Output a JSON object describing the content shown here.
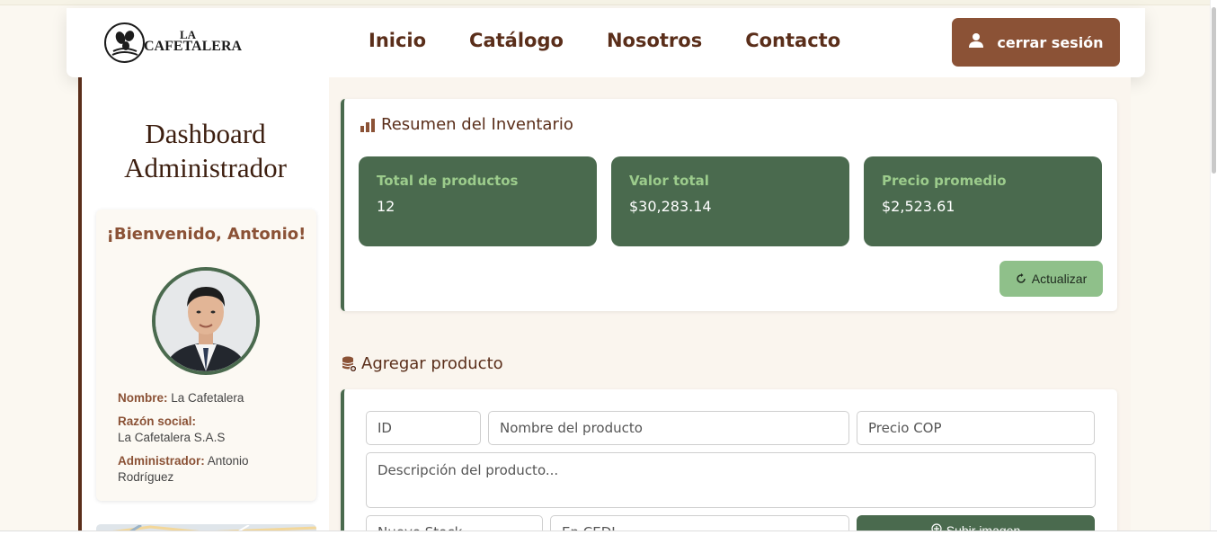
{
  "brand": {
    "logo_small": "LA",
    "logo_name": "CAFETALERA"
  },
  "nav": {
    "links": [
      "Inicio",
      "Catálogo",
      "Nosotros",
      "Contacto"
    ],
    "logout_label": "cerrar sesión",
    "logout_icon": "user-icon"
  },
  "sidebar": {
    "title_line1": "Dashboard",
    "title_line2": "Administrador",
    "welcome": "¡Bienvenido, Antonio!",
    "fields": {
      "nombre_label": "Nombre:",
      "nombre_value": "La Cafetalera",
      "razon_label": "Razón social:",
      "razon_value": "La Cafetalera S.A.S",
      "admin_label": "Administrador:",
      "admin_value": "Antonio Rodríguez"
    }
  },
  "inventory": {
    "title": "Resumen del Inventario",
    "title_icon": "bar-chart-icon",
    "stats": [
      {
        "label": "Total de productos",
        "value": "12"
      },
      {
        "label": "Valor total",
        "value": "$30,283.14"
      },
      {
        "label": "Precio promedio",
        "value": "$2,523.61"
      }
    ],
    "refresh_label": "Actualizar",
    "refresh_icon": "refresh-icon"
  },
  "add_product": {
    "title": "Agregar producto",
    "title_icon": "database-add-icon",
    "placeholders": {
      "id": "ID",
      "name": "Nombre del producto",
      "price": "Precio COP",
      "description": "Descripción del producto...",
      "stock": "Nuevo Stock",
      "select": "En CEDI"
    },
    "upload_label": "Subir imagen",
    "upload_icon": "upload-icon"
  },
  "colors": {
    "brown": "#5a2e1a",
    "accent_brown": "#8b5236",
    "green": "#4a6a4e",
    "light_green": "#8fc08a",
    "stat_label": "#9ccc8c",
    "background": "#faf5ee"
  }
}
